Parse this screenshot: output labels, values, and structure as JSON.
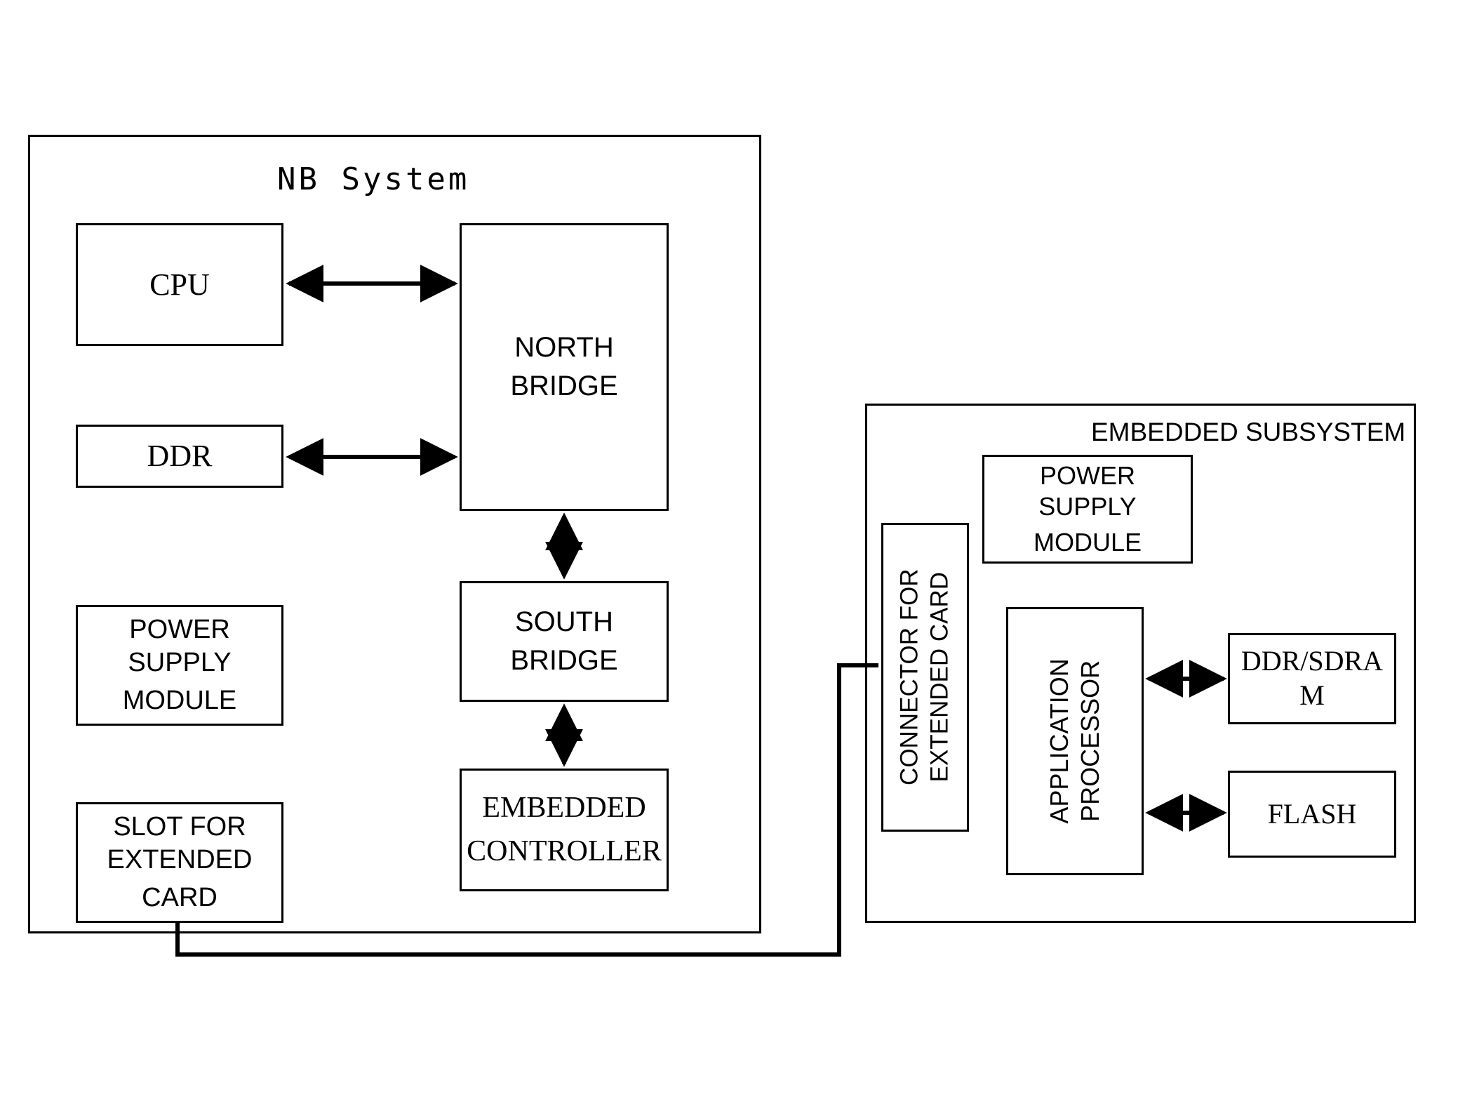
{
  "diagram": {
    "title_nb_system": "NB System",
    "title_embedded_subsystem": "EMBEDDED SUBSYSTEM"
  },
  "nb_system": {
    "label": "NB System",
    "blocks": {
      "cpu": "CPU",
      "ddr": "DDR",
      "power_supply_module": {
        "line1": "POWER",
        "line2": "SUPPLY",
        "line3": "MODULE"
      },
      "slot_for_extended_card": {
        "line1": "SLOT FOR",
        "line2": "EXTENDED",
        "line3": "CARD"
      },
      "north_bridge": {
        "line1": "NORTH",
        "line2": "BRIDGE"
      },
      "south_bridge": {
        "line1": "SOUTH",
        "line2": "BRIDGE"
      },
      "embedded_controller": {
        "line1": "EMBEDDED",
        "line2": "CONTROLLER"
      }
    }
  },
  "embedded_subsystem": {
    "label": "EMBEDDED SUBSYSTEM",
    "blocks": {
      "connector_for_extended_card": {
        "line1": "CONNECTOR FOR",
        "line2": "EXTENDED CARD"
      },
      "power_supply_module": {
        "line1": "POWER",
        "line2": "SUPPLY",
        "line3": "MODULE"
      },
      "application_processor": {
        "line1": "APPLICATION",
        "line2": "PROCESSOR"
      },
      "ddr_sdram": {
        "line1": "DDR/SDRA",
        "line2": "M"
      },
      "flash": "FLASH"
    }
  },
  "connections": [
    {
      "from": "CPU",
      "to": "NORTH BRIDGE",
      "style": "double-arrow-horizontal"
    },
    {
      "from": "DDR",
      "to": "NORTH BRIDGE",
      "style": "double-arrow-horizontal"
    },
    {
      "from": "NORTH BRIDGE",
      "to": "SOUTH BRIDGE",
      "style": "double-arrow-vertical"
    },
    {
      "from": "SOUTH BRIDGE",
      "to": "EMBEDDED CONTROLLER",
      "style": "double-arrow-vertical"
    },
    {
      "from": "APPLICATION PROCESSOR",
      "to": "DDR/SDRAM",
      "style": "double-arrow-horizontal"
    },
    {
      "from": "APPLICATION PROCESSOR",
      "to": "FLASH",
      "style": "double-arrow-horizontal"
    },
    {
      "from": "SLOT FOR EXTENDED CARD",
      "to": "CONNECTOR FOR EXTENDED CARD",
      "style": "plain-line"
    }
  ],
  "colors": {
    "stroke": "#000000",
    "background": "#ffffff"
  }
}
